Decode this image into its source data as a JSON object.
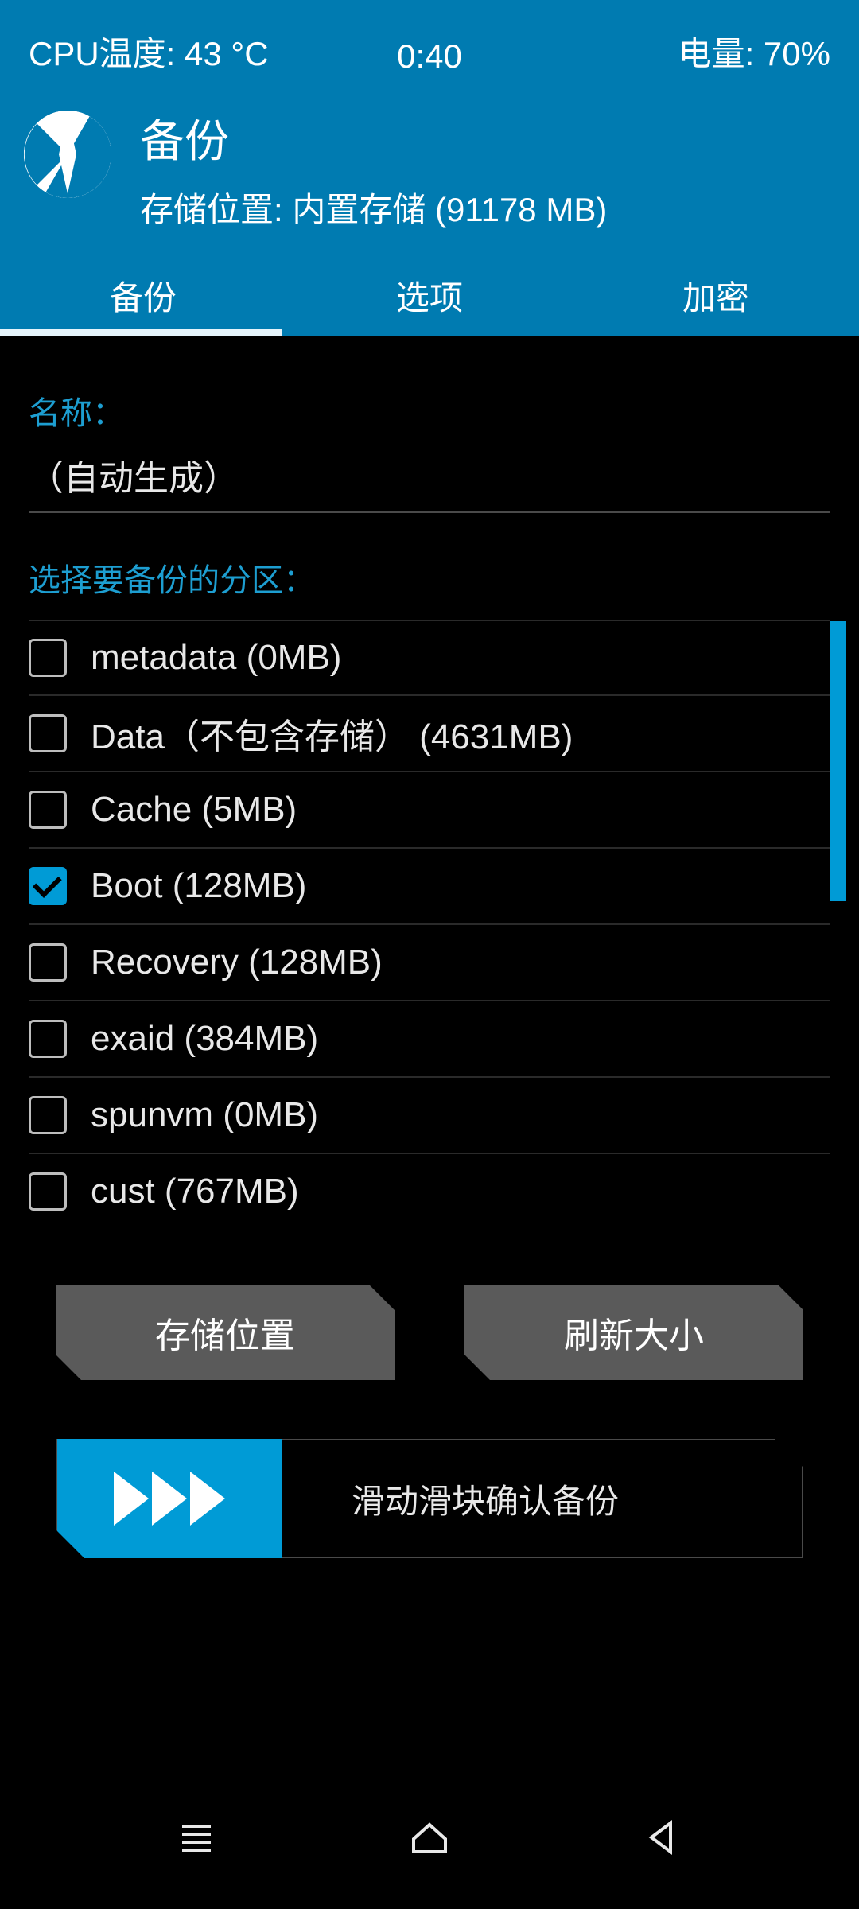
{
  "status": {
    "cpu": "CPU温度: 43 °C",
    "time": "0:40",
    "battery": "电量: 70%"
  },
  "header": {
    "title": "备份",
    "storage": "存储位置: 内置存储 (91178 MB)"
  },
  "tabs": {
    "t0": "备份",
    "t1": "选项",
    "t2": "加密"
  },
  "name": {
    "label": "名称：",
    "value": "（自动生成）"
  },
  "partitions": {
    "label": "选择要备份的分区：",
    "items": [
      {
        "label": "metadata (0MB)",
        "checked": false
      },
      {
        "label": "Data（不包含存储） (4631MB)",
        "checked": false
      },
      {
        "label": "Cache (5MB)",
        "checked": false
      },
      {
        "label": "Boot (128MB)",
        "checked": true
      },
      {
        "label": "Recovery (128MB)",
        "checked": false
      },
      {
        "label": "exaid (384MB)",
        "checked": false
      },
      {
        "label": "spunvm (0MB)",
        "checked": false
      },
      {
        "label": "cust (767MB)",
        "checked": false
      }
    ]
  },
  "buttons": {
    "storage": "存储位置",
    "refresh": "刷新大小"
  },
  "slider": {
    "text": "滑动滑块确认备份"
  }
}
